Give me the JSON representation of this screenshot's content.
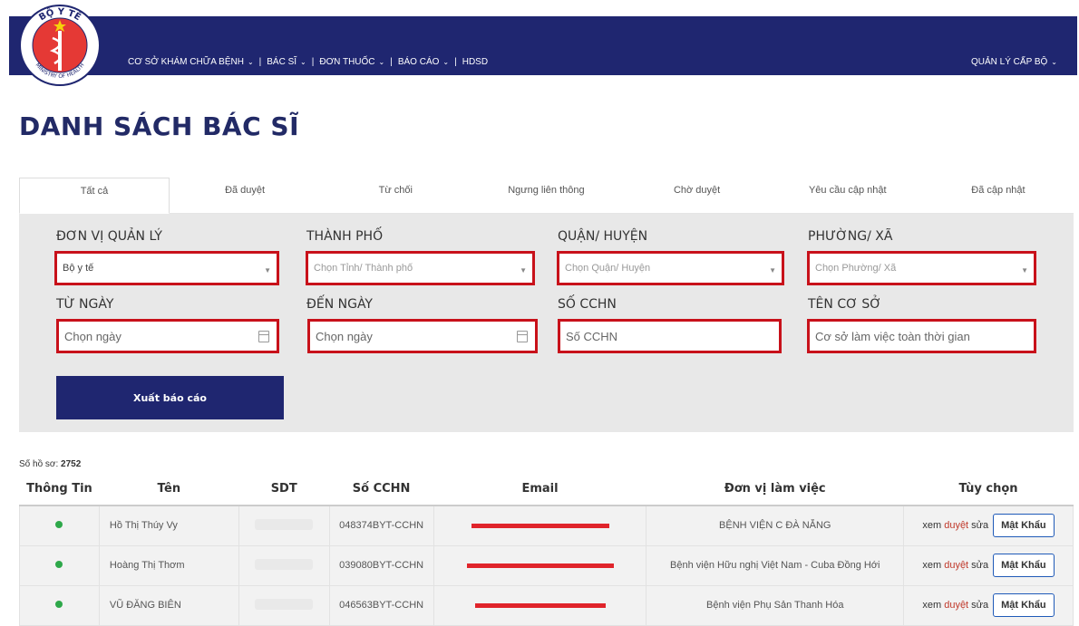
{
  "header": {
    "logo_text_top": "BỘ Y TẾ",
    "logo_text_bottom": "MINISTRY OF HEALTH",
    "nav": [
      {
        "label": "CƠ SỞ KHÁM CHỮA BỆNH",
        "dropdown": true
      },
      {
        "label": "BÁC SĨ",
        "dropdown": true
      },
      {
        "label": "ĐƠN THUỐC",
        "dropdown": true
      },
      {
        "label": "BÁO CÁO",
        "dropdown": true
      },
      {
        "label": "HDSD",
        "dropdown": false
      }
    ],
    "separator": "|",
    "right_menu": "QUẢN LÝ CẤP BỘ",
    "chevron": "⌄"
  },
  "page": {
    "title": "DANH SÁCH BÁC SĨ"
  },
  "tabs": [
    "Tất cả",
    "Đã duyệt",
    "Từ chối",
    "Ngưng liên thông",
    "Chờ duyệt",
    "Yêu cầu cập nhật",
    "Đã cập nhật"
  ],
  "filters": {
    "don_vi_label": "ĐƠN VỊ QUẢN LÝ",
    "don_vi_value": "Bộ y tế",
    "thanh_pho_label": "THÀNH PHỐ",
    "thanh_pho_placeholder": "Chọn Tỉnh/ Thành phố",
    "quan_label": "QUẬN/ HUYỆN",
    "quan_placeholder": "Chọn Quận/ Huyện",
    "phuong_label": "PHƯỜNG/ XÃ",
    "phuong_placeholder": "Chọn Phường/ Xã",
    "tu_ngay_label": "TỪ NGÀY",
    "tu_ngay_placeholder": "Chọn ngày",
    "den_ngay_label": "ĐẾN NGÀY",
    "den_ngay_placeholder": "Chọn ngày",
    "cchn_label": "SỐ CCHN",
    "cchn_placeholder": "Số CCHN",
    "ten_co_so_label": "TÊN CƠ SỞ",
    "ten_co_so_value": "Cơ sở làm việc toàn thời gian",
    "export_label": "Xuất báo cáo"
  },
  "count": {
    "label": "Số hồ sơ:",
    "value": "2752"
  },
  "table": {
    "headers": [
      "Thông Tin",
      "Tên",
      "SDT",
      "Số CCHN",
      "Email",
      "Đơn vị làm việc",
      "Tùy chọn"
    ],
    "rows": [
      {
        "name": "Hồ Thị Thúy Vy",
        "cchn": "048374BYT-CCHN",
        "unit": "BỆNH VIỆN C ĐÀ NẴNG"
      },
      {
        "name": "Hoàng Thị Thơm",
        "cchn": "039080BYT-CCHN",
        "unit": "Bệnh viện Hữu nghị Việt Nam - Cuba Đồng Hới"
      },
      {
        "name": "VŨ ĐĂNG BIÊN",
        "cchn": "046563BYT-CCHN",
        "unit": "Bệnh viện Phụ Sản Thanh Hóa"
      }
    ],
    "actions": {
      "view": "xem",
      "approve": "duyệt",
      "edit": "sửa",
      "password": "Mật Khẩu"
    },
    "status_color": "#2ea84a"
  },
  "colors": {
    "brand": "#1f2670",
    "highlight": "#c8111a"
  }
}
